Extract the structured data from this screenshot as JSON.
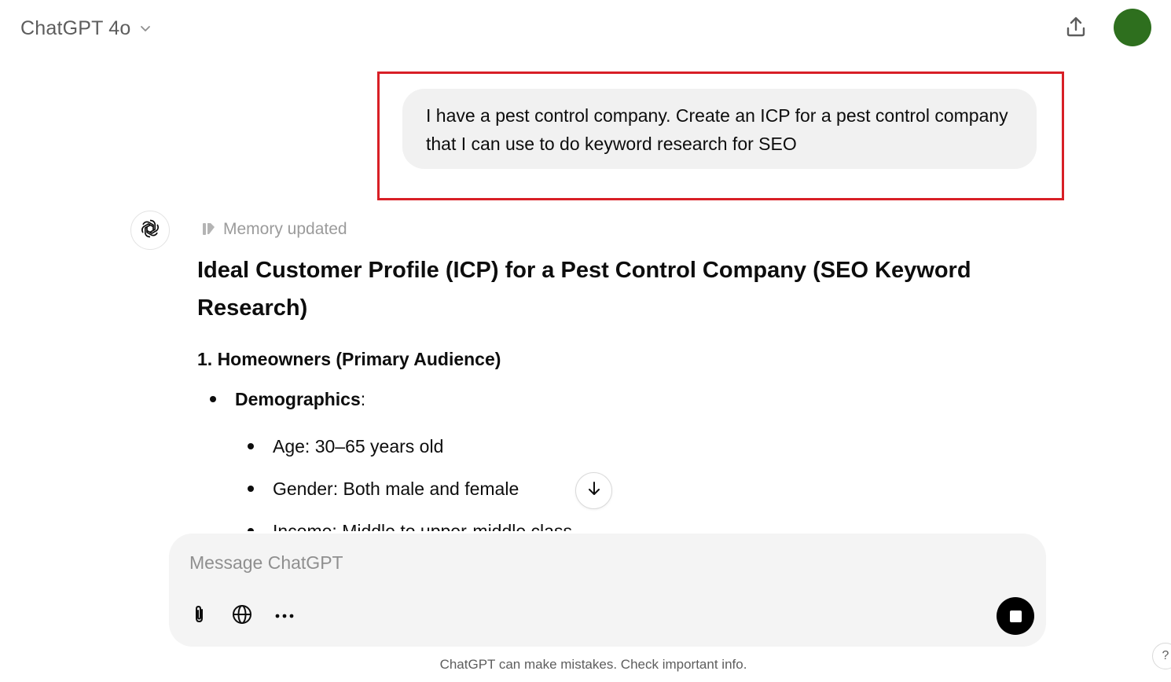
{
  "header": {
    "model_name": "ChatGPT 4o",
    "model_dropdown_icon": "chevron-down-icon",
    "share_icon": "share-upload-icon",
    "avatar_color": "#2e6f1e"
  },
  "conversation": {
    "user_message": "I have a pest control company. Create an ICP for a pest control company that I can use to do keyword research for SEO",
    "highlight_color": "#d81f26",
    "assistant": {
      "avatar_icon": "openai-logo-icon",
      "memory_icon": "memory-pencil-icon",
      "memory_status": "Memory updated",
      "title": "Ideal Customer Profile (ICP) for a Pest Control Company (SEO Keyword Research)",
      "section_heading": "1. Homeowners (Primary Audience)",
      "demographics_label": "Demographics",
      "demographics_colon": ":",
      "sub_bullets": [
        "Age: 30–65 years old",
        "Gender: Both male and female",
        "Income: Middle to upper-middle class"
      ]
    },
    "scroll_down_icon": "arrow-down-icon"
  },
  "composer": {
    "placeholder": "Message ChatGPT",
    "value": "",
    "attach_icon": "paperclip-icon",
    "search_icon": "globe-icon",
    "more_icon": "more-dots-icon",
    "stop_icon": "stop-square-icon"
  },
  "footer": {
    "disclaimer": "ChatGPT can make mistakes. Check important info.",
    "help_label": "?"
  }
}
